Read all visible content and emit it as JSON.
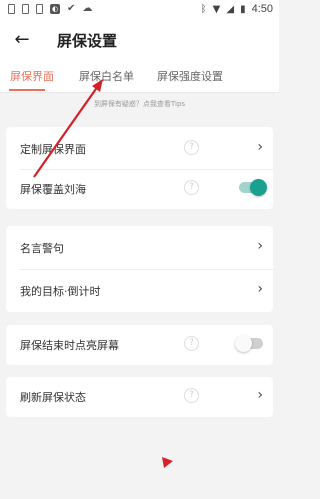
{
  "status_bar": {
    "time": "4:50",
    "left_icons": [
      "sim-icon",
      "file-icon",
      "phone-icon",
      "app-icon",
      "check-icon",
      "cloud-icon"
    ],
    "right_icons": [
      "bluetooth-icon",
      "wifi-icon",
      "signal-icon",
      "battery-icon"
    ]
  },
  "header": {
    "title": "屏保设置"
  },
  "tabs": [
    {
      "label": "屏保界面",
      "active": true
    },
    {
      "label": "屏保白名单",
      "active": false
    },
    {
      "label": "屏保强度设置",
      "active": false
    }
  ],
  "tip": "到屏保有疑惑？点我查看Tips",
  "sections": [
    {
      "rows": [
        {
          "label": "定制屏保界面",
          "type": "chevron"
        },
        {
          "label": "屏保覆盖刘海",
          "type": "toggle",
          "value": true
        }
      ]
    },
    {
      "rows": [
        {
          "label": "名言警句",
          "type": "chevron"
        },
        {
          "label": "我的目标·倒计时",
          "type": "chevron"
        }
      ]
    },
    {
      "rows": [
        {
          "label": "屏保结束时点亮屏幕",
          "type": "toggle",
          "value": false
        }
      ]
    },
    {
      "rows": [
        {
          "label": "刷新屏保状态",
          "type": "chevron"
        }
      ]
    }
  ],
  "colors": {
    "accent": "#e8735a",
    "toggle_on": "#1aa08e",
    "annotation_red": "#d42027"
  }
}
